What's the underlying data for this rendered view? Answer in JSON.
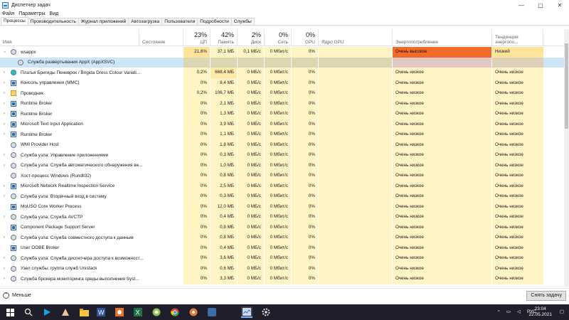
{
  "window": {
    "title": "Диспетчер задач",
    "minimize": "—",
    "maximize": "▢",
    "close": "✕"
  },
  "menu": [
    "Файл",
    "Параметры",
    "Вид"
  ],
  "tabs": [
    "Процессы",
    "Производительность",
    "Журнал приложений",
    "Автозагрузка",
    "Пользователи",
    "Подробности",
    "Службы"
  ],
  "columns": {
    "name": "Имя",
    "status": "Состояние",
    "cpu": {
      "pct": "23%",
      "label": "ЦП"
    },
    "mem": {
      "pct": "42%",
      "label": "Память"
    },
    "disk": {
      "pct": "2%",
      "label": "Диск"
    },
    "net": {
      "pct": "0%",
      "label": "Сеть"
    },
    "gpu": {
      "pct": "0%",
      "label": "GPU"
    },
    "gpuengine": "Ядро GPU",
    "energy": "Энергопотребление",
    "trend": "Тенденция энергопо..."
  },
  "processes": [
    {
      "name": "wsappx",
      "chev": "›",
      "expanded": true,
      "icon": "gear",
      "cpu": "21,6%",
      "mem": "37,1 МБ",
      "disk": "0,1 МБ/с",
      "net": "0 Мбит/с",
      "gpu": "0%",
      "energy": "Очень высокое",
      "trend": "Низкий",
      "cpuhi": true
    },
    {
      "name": "Служба развертывания AppX (AppXSVC)",
      "chev": "",
      "child": true,
      "selected": true,
      "icon": "gear",
      "cpu": "",
      "mem": "",
      "disk": "",
      "net": "",
      "gpu": "",
      "energy": "",
      "trend": ""
    },
    {
      "name": "Платья Бригиды Пеневрок / Brigida Dress Colour Variati...",
      "chev": "›",
      "icon": "edge",
      "cpu": "0,2%",
      "mem": "668,4 МБ",
      "disk": "0 МБ/с",
      "net": "0 Мбит/с",
      "gpu": "0%",
      "energy": "Очень низкое",
      "trend": "Очень низкое",
      "memhi": true
    },
    {
      "name": "Консоль управления (MMC)",
      "chev": "›",
      "icon": "blue",
      "cpu": "0%",
      "mem": "8,4 МБ",
      "disk": "0 МБ/с",
      "net": "0 Мбит/с",
      "gpu": "0%",
      "energy": "Очень низкое",
      "trend": "Очень низкое"
    },
    {
      "name": "Проводник",
      "chev": "›",
      "icon": "folder",
      "cpu": "0,2%",
      "mem": "106,7 МБ",
      "disk": "0 МБ/с",
      "net": "0 Мбит/с",
      "gpu": "0%",
      "energy": "Очень низкое",
      "trend": "Очень низкое"
    },
    {
      "name": "Runtime Broker",
      "chev": "›",
      "icon": "blue",
      "cpu": "0%",
      "mem": "2,1 МБ",
      "disk": "0 МБ/с",
      "net": "0 Мбит/с",
      "gpu": "0%",
      "energy": "Очень низкое",
      "trend": "Очень низкое"
    },
    {
      "name": "Runtime Broker",
      "chev": "›",
      "icon": "blue",
      "cpu": "0%",
      "mem": "1,3 МБ",
      "disk": "0 МБ/с",
      "net": "0 Мбит/с",
      "gpu": "0%",
      "energy": "Очень низкое",
      "trend": "Очень низкое"
    },
    {
      "name": "Microsoft Text Input Application",
      "chev": "›",
      "icon": "blue",
      "cpu": "0%",
      "mem": "3,9 МБ",
      "disk": "0 МБ/с",
      "net": "0 Мбит/с",
      "gpu": "0%",
      "energy": "Очень низкое",
      "trend": "Очень низкое"
    },
    {
      "name": "Runtime Broker",
      "chev": "›",
      "icon": "blue",
      "cpu": "0%",
      "mem": "1,1 МБ",
      "disk": "0 МБ/с",
      "net": "0 Мбит/с",
      "gpu": "0%",
      "energy": "Очень низкое",
      "trend": "Очень низкое"
    },
    {
      "name": "WMI Provider Host",
      "chev": "",
      "icon": "gear",
      "cpu": "0%",
      "mem": "1,8 МБ",
      "disk": "0 МБ/с",
      "net": "0 Мбит/с",
      "gpu": "0%",
      "energy": "Очень низкое",
      "trend": "Очень низкое"
    },
    {
      "name": "Служба узла: Управление приложениями",
      "chev": "›",
      "icon": "gear",
      "cpu": "0%",
      "mem": "0,3 МБ",
      "disk": "0 МБ/с",
      "net": "0 Мбит/с",
      "gpu": "0%",
      "energy": "Очень низкое",
      "trend": "Очень низкое"
    },
    {
      "name": "Служба узла: Служба автоматического обнаружения ве...",
      "chev": "›",
      "icon": "gear",
      "cpu": "0%",
      "mem": "1,0 МБ",
      "disk": "0 МБ/с",
      "net": "0 Мбит/с",
      "gpu": "0%",
      "energy": "Очень низкое",
      "trend": "Очень низкое"
    },
    {
      "name": "Хост-процесс Windows (Rundll32)",
      "chev": "",
      "icon": "gear",
      "cpu": "0%",
      "mem": "0,8 МБ",
      "disk": "0 МБ/с",
      "net": "0 Мбит/с",
      "gpu": "0%",
      "energy": "Очень низкое",
      "trend": "Очень низкое"
    },
    {
      "name": "Microsoft Network Realtime Inspection Service",
      "chev": "›",
      "icon": "blue",
      "cpu": "0%",
      "mem": "2,5 МБ",
      "disk": "0 МБ/с",
      "net": "0 Мбит/с",
      "gpu": "0%",
      "energy": "Очень низкое",
      "trend": "Очень низкое"
    },
    {
      "name": "Служба узла: Вторичный вход в систему",
      "chev": "›",
      "icon": "gear",
      "cpu": "0%",
      "mem": "0,3 МБ",
      "disk": "0 МБ/с",
      "net": "0 Мбит/с",
      "gpu": "0%",
      "energy": "Очень низкое",
      "trend": "Очень низкое"
    },
    {
      "name": "MoUSO Core Worker Process",
      "chev": "",
      "icon": "blue",
      "cpu": "0%",
      "mem": "12,0 МБ",
      "disk": "0 МБ/с",
      "net": "0 Мбит/с",
      "gpu": "0%",
      "energy": "Очень низкое",
      "trend": "Очень низкое"
    },
    {
      "name": "Служба узла: Служба AVCTP",
      "chev": "›",
      "icon": "gear",
      "cpu": "0%",
      "mem": "0,4 МБ",
      "disk": "0 МБ/с",
      "net": "0 Мбит/с",
      "gpu": "0%",
      "energy": "Очень низкое",
      "trend": "Очень низкое"
    },
    {
      "name": "Component Package Support Server",
      "chev": "",
      "icon": "blue",
      "cpu": "0%",
      "mem": "0,8 МБ",
      "disk": "0 МБ/с",
      "net": "0 Мбит/с",
      "gpu": "0%",
      "energy": "Очень низкое",
      "trend": "Очень низкое"
    },
    {
      "name": "Служба узла: Служба совместного доступа к данным",
      "chev": "›",
      "icon": "gear",
      "cpu": "0%",
      "mem": "0,8 МБ",
      "disk": "0 МБ/с",
      "net": "0 Мбит/с",
      "gpu": "0%",
      "energy": "Очень низкое",
      "trend": "Очень низкое"
    },
    {
      "name": "User OOBE Broker",
      "chev": "",
      "icon": "blue",
      "cpu": "0%",
      "mem": "0,4 МБ",
      "disk": "0 МБ/с",
      "net": "0 Мбит/с",
      "gpu": "0%",
      "energy": "Очень низкое",
      "trend": "Очень низкое"
    },
    {
      "name": "Служба узла: Служба диспетчера доступа к возможност...",
      "chev": "›",
      "icon": "gear",
      "cpu": "0%",
      "mem": "3,6 МБ",
      "disk": "0 МБ/с",
      "net": "0 Мбит/с",
      "gpu": "0%",
      "energy": "Очень низкое",
      "trend": "Очень низкое"
    },
    {
      "name": "Узел службы: группа служб Unistack",
      "chev": "›",
      "icon": "gear",
      "cpu": "0%",
      "mem": "0,6 МБ",
      "disk": "0 МБ/с",
      "net": "0 Мбит/с",
      "gpu": "0%",
      "energy": "Очень низкое",
      "trend": "Очень низкое"
    },
    {
      "name": "Служба брокера мониторинга среды выполнения Syst...",
      "chev": "›",
      "icon": "gear",
      "cpu": "0%",
      "mem": "3,3 МБ",
      "disk": "0 МБ/с",
      "net": "0 Мбит/с",
      "gpu": "0%",
      "energy": "Очень низкое",
      "trend": "Очень низкое"
    }
  ],
  "footer": {
    "fewer": "Меньше",
    "fewer_icon": "⌃",
    "end_task": "Снять задачу"
  },
  "taskbar": {
    "lang": "РУС",
    "time": "23:04",
    "date": "22.05.2021",
    "icons": [
      "windows-logo-icon",
      "search-icon",
      "media-player-icon",
      "game-icon",
      "folder-icon",
      "word-icon",
      "photos-icon",
      "excel-icon",
      "android-icon",
      "chrome-icon",
      "app-icon",
      "app-icon",
      "task-manager-icon",
      "settings-icon"
    ]
  },
  "colors": {
    "very_high": "#f26b2a",
    "cell_bg": "#fff4c4",
    "selected_row": "#cde6f7",
    "taskbar": "#1f1f2b"
  }
}
